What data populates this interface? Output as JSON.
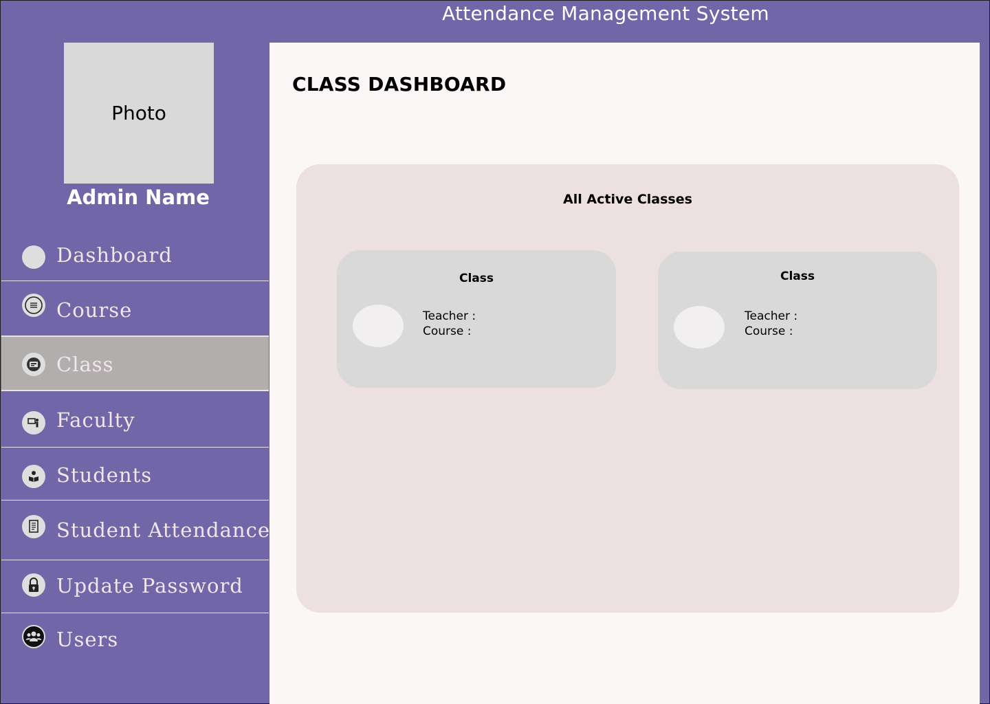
{
  "app": {
    "title": "Attendance Management System"
  },
  "sidebar": {
    "photo_label": "Photo",
    "admin_name": "Admin Name",
    "items": [
      {
        "label": "Dashboard",
        "icon": "circle-icon",
        "active": false
      },
      {
        "label": "Course",
        "icon": "list-icon",
        "active": false
      },
      {
        "label": "Class",
        "icon": "classroom-icon",
        "active": true
      },
      {
        "label": "Faculty",
        "icon": "teacher-board-icon",
        "active": false
      },
      {
        "label": "Students",
        "icon": "student-reading-icon",
        "active": false
      },
      {
        "label": "Student Attendance",
        "icon": "document-icon",
        "active": false
      },
      {
        "label": "Update Password",
        "icon": "lock-icon",
        "active": false
      },
      {
        "label": "Users",
        "icon": "users-group-icon",
        "active": false
      }
    ]
  },
  "main": {
    "page_title": "CLASS DASHBOARD",
    "panel": {
      "title": "All Active Classes",
      "cards": [
        {
          "title": "Class",
          "teacher_label": "Teacher :",
          "course_label": "Course :"
        },
        {
          "title": "Class",
          "teacher_label": "Teacher :",
          "course_label": "Course :"
        }
      ]
    }
  },
  "colors": {
    "brand_purple": "#7066a8",
    "active_nav": "#b3aeae",
    "content_bg": "#fbf7f7",
    "panel_bg": "#ece0e0",
    "card_bg": "#d9d9d9"
  }
}
